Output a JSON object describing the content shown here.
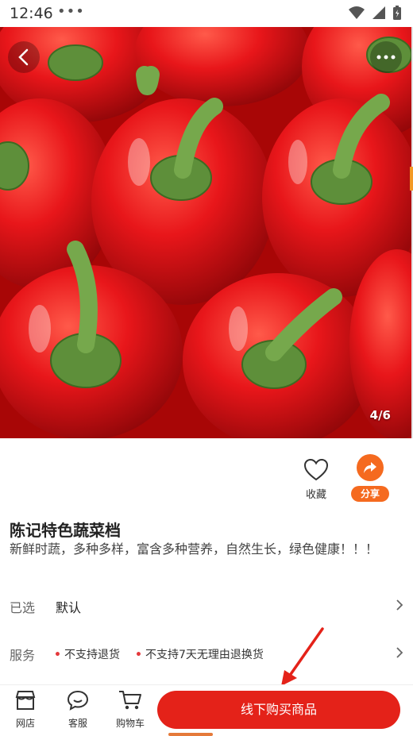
{
  "status": {
    "time": "12:46",
    "dots": "•••"
  },
  "hero": {
    "page_indicator": "4/6"
  },
  "actions": {
    "favorite_label": "收藏",
    "share_label": "分享"
  },
  "product": {
    "title": "陈记特色蔬菜档",
    "description": "新鲜时蔬，多种多样，富含多种营养，自然生长，绿色健康！！！"
  },
  "selection": {
    "label": "已选",
    "value": "默认"
  },
  "service": {
    "label": "服务",
    "items": [
      "不支持退货",
      "不支持7天无理由退换货"
    ]
  },
  "bottom_bar": {
    "tabs": [
      {
        "label": "网店",
        "icon": "shop-icon"
      },
      {
        "label": "客服",
        "icon": "chat-icon"
      },
      {
        "label": "购物车",
        "icon": "cart-icon"
      }
    ],
    "buy_label": "线下购买商品"
  },
  "colors": {
    "accent": "#e42219",
    "share": "#f56a1f",
    "service_dot": "#e4393c"
  }
}
